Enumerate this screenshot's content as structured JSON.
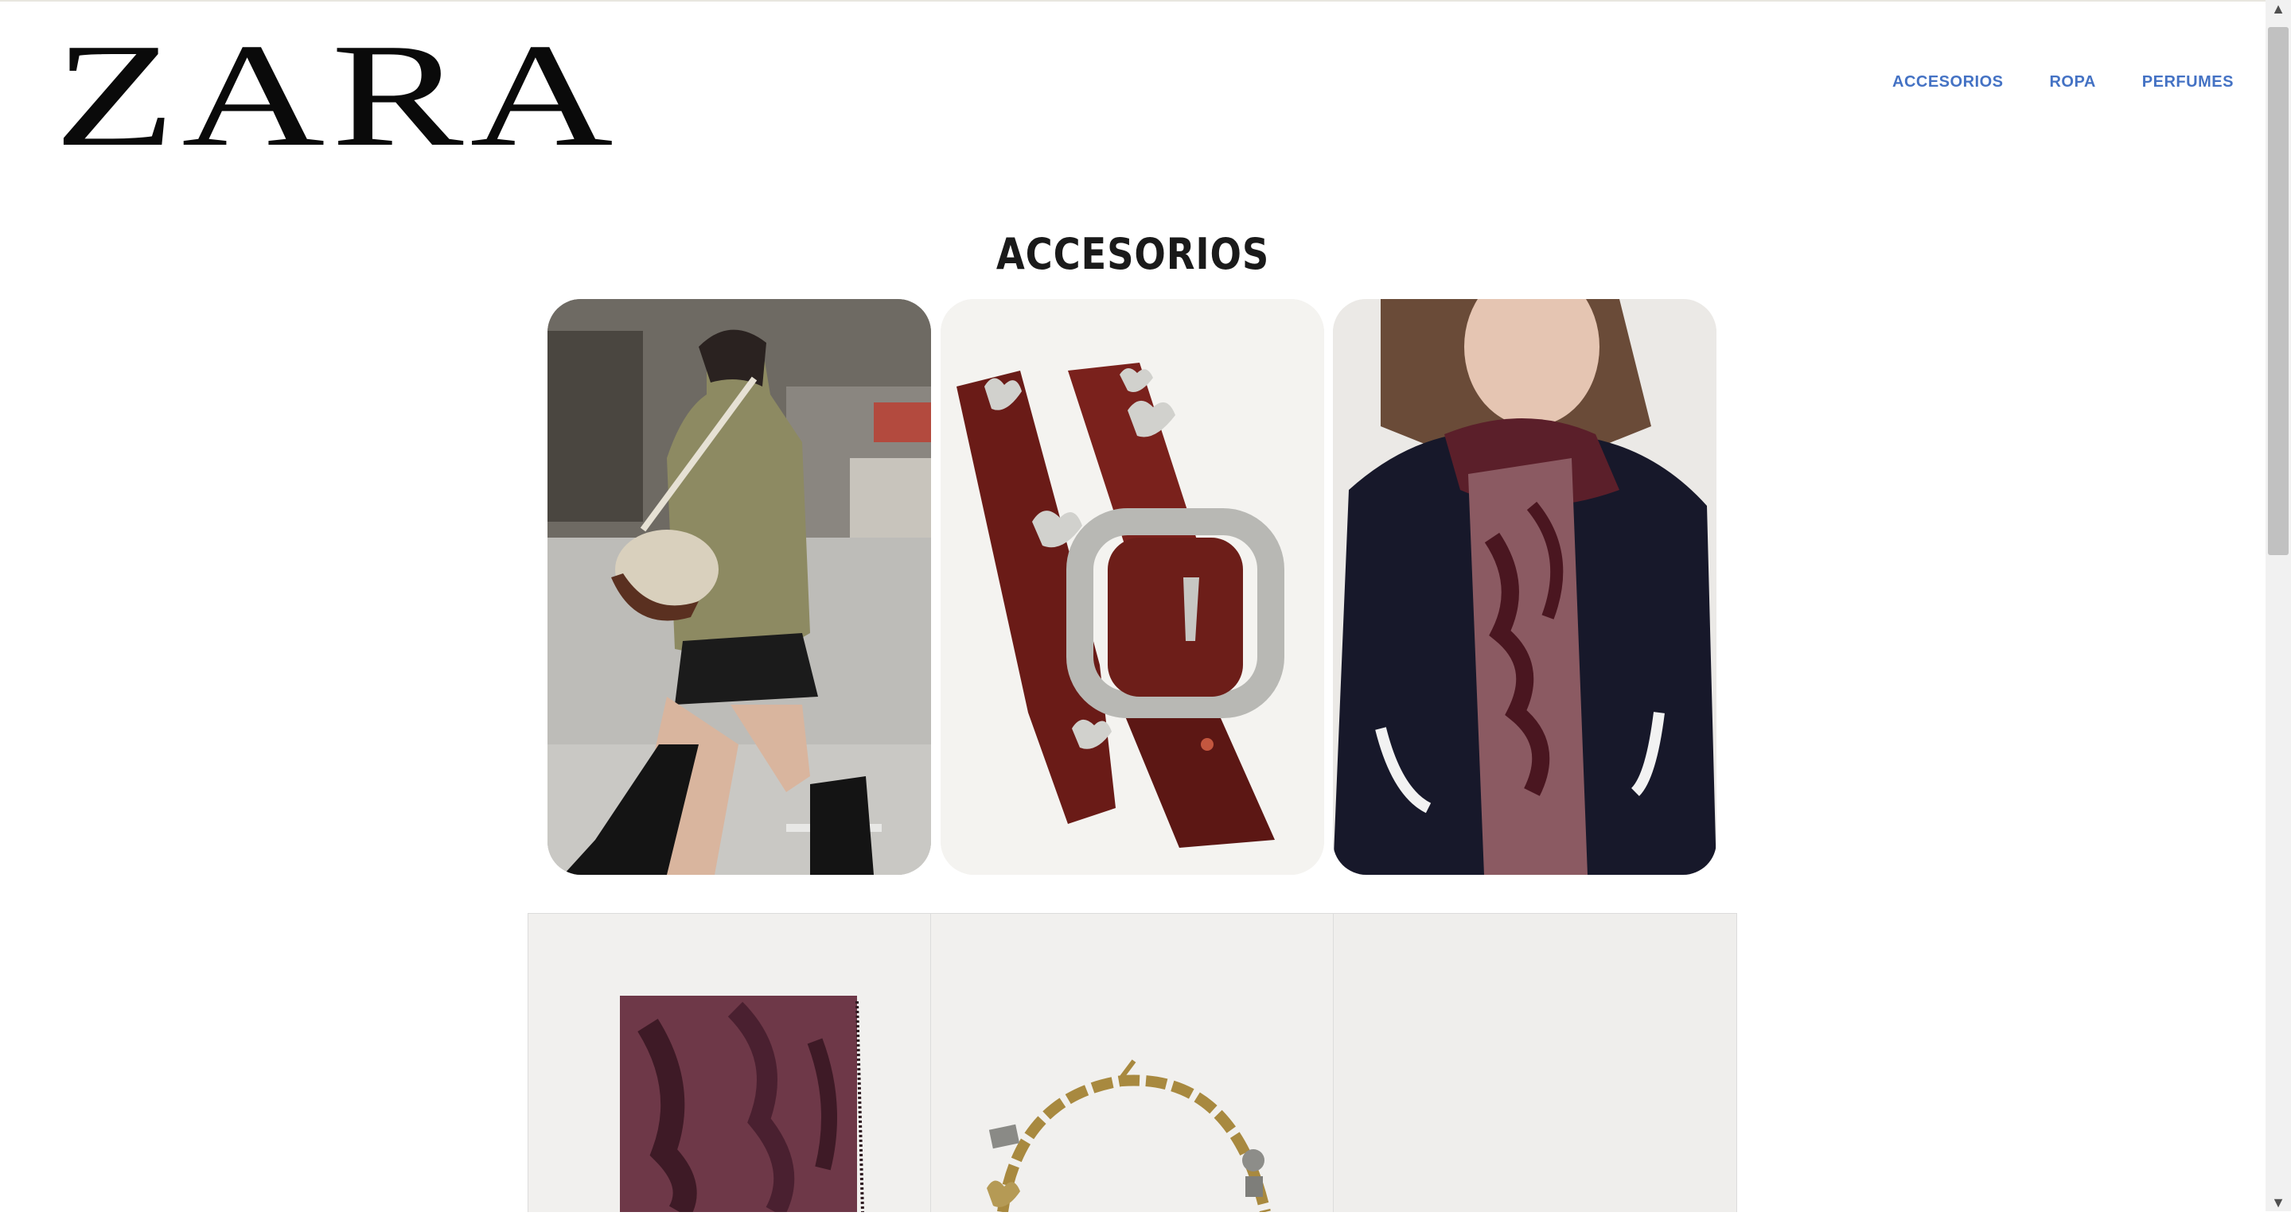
{
  "header": {
    "logo_text": "ZARA",
    "nav": [
      {
        "label": "ACCESORIOS"
      },
      {
        "label": "ROPA"
      },
      {
        "label": "PERFUMES"
      }
    ],
    "nav_color": "#4472c4"
  },
  "main": {
    "section_title": "ACCESORIOS",
    "featured": [
      {
        "subject": "woman-walking-with-bag-photo"
      },
      {
        "subject": "burgundy-heart-stud-belt-photo"
      },
      {
        "subject": "burgundy-printed-scarf-model-photo"
      }
    ],
    "products": [
      {
        "subject": "burgundy-scarf-product-photo"
      },
      {
        "subject": "gold-charm-necklace-product-photo"
      },
      {
        "subject": "empty-product-placeholder"
      }
    ]
  },
  "scrollbar": {
    "up_icon": "▲",
    "down_icon": "▼"
  }
}
